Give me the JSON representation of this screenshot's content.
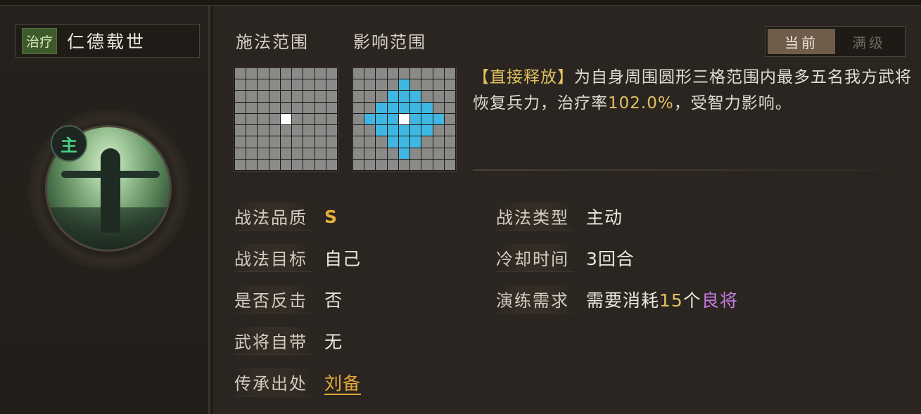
{
  "skill": {
    "tag": "治疗",
    "name": "仁德载世",
    "badge": "主"
  },
  "range": {
    "cast_label": "施法范围",
    "effect_label": "影响范围",
    "cast_grid_size": 9,
    "effect_grid_size": 9
  },
  "level_tabs": {
    "current": "当前",
    "max": "满级"
  },
  "description": {
    "prefix": "【直接释放】",
    "text1": "为自身周围圆形三格范围内最多五名我方武将恢复兵力，治疗率",
    "rate": "102.0%",
    "text2": "，受智力影响。"
  },
  "stats_left": [
    {
      "key": "战法品质",
      "value": "S"
    },
    {
      "key": "战法目标",
      "value": "自己"
    },
    {
      "key": "是否反击",
      "value": "否"
    },
    {
      "key": "武将自带",
      "value": "无"
    },
    {
      "key": "传承出处",
      "value": "刘备"
    }
  ],
  "stats_right": [
    {
      "key": "战法类型",
      "value": "主动"
    },
    {
      "key": "冷却时间",
      "value": "3回合"
    },
    {
      "key": "演练需求",
      "value_prefix": "需要消耗",
      "count": "15",
      "unit": "个",
      "item": "良将"
    }
  ],
  "colors": {
    "aoe_cell": "#3fb7e2",
    "self_cell": "#ffffff",
    "empty_cell": "#8a8a88",
    "quality_gold": "#e5b13a",
    "highlight_number": "#e0c060",
    "item_purple": "#c77be0",
    "heal_tag_green": "#3e5a2c",
    "main_badge_green": "#4ad083"
  }
}
